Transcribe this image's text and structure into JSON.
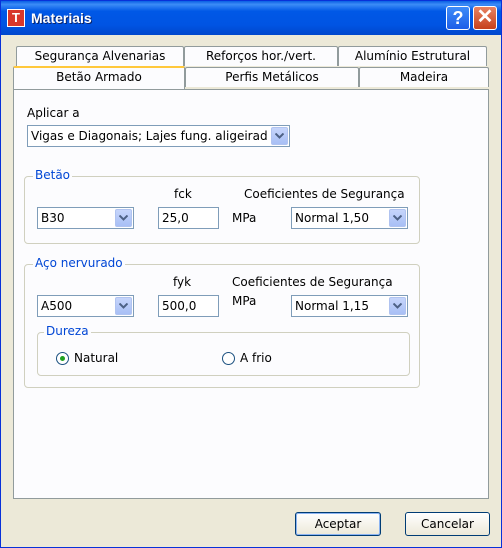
{
  "window": {
    "title": "Materiais",
    "app_icon_letter": "T"
  },
  "titlebar": {
    "help_glyph": "?",
    "close_glyph": "✕"
  },
  "tabs": {
    "back": [
      "Segurança Alvenarias",
      "Reforços hor./vert.",
      "Alumínio Estrutural"
    ],
    "front": [
      "Betão Armado",
      "Perfis Metálicos",
      "Madeira"
    ],
    "active": "Betão Armado"
  },
  "apply": {
    "label": "Aplicar a",
    "value": "Vigas e Diagonais; Lajes fung. aligeirad"
  },
  "concrete": {
    "title": "Betão",
    "grade_value": "B30",
    "fck_label": "fck",
    "fck_value": "25,0",
    "unit": "MPa",
    "safety_label": "Coeficientes de Segurança",
    "safety_value": "Normal 1,50"
  },
  "steel": {
    "title": "Aço nervurado",
    "grade_value": "A500",
    "fyk_label": "fyk",
    "fyk_value": "500,0",
    "unit": "MPa",
    "safety_label": "Coeficientes de Segurança",
    "safety_value": "Normal 1,15",
    "hardness": {
      "title": "Dureza",
      "options": [
        "Natural",
        "A frio"
      ],
      "selected": "Natural"
    }
  },
  "buttons": {
    "ok": "Aceptar",
    "cancel": "Cancelar"
  }
}
